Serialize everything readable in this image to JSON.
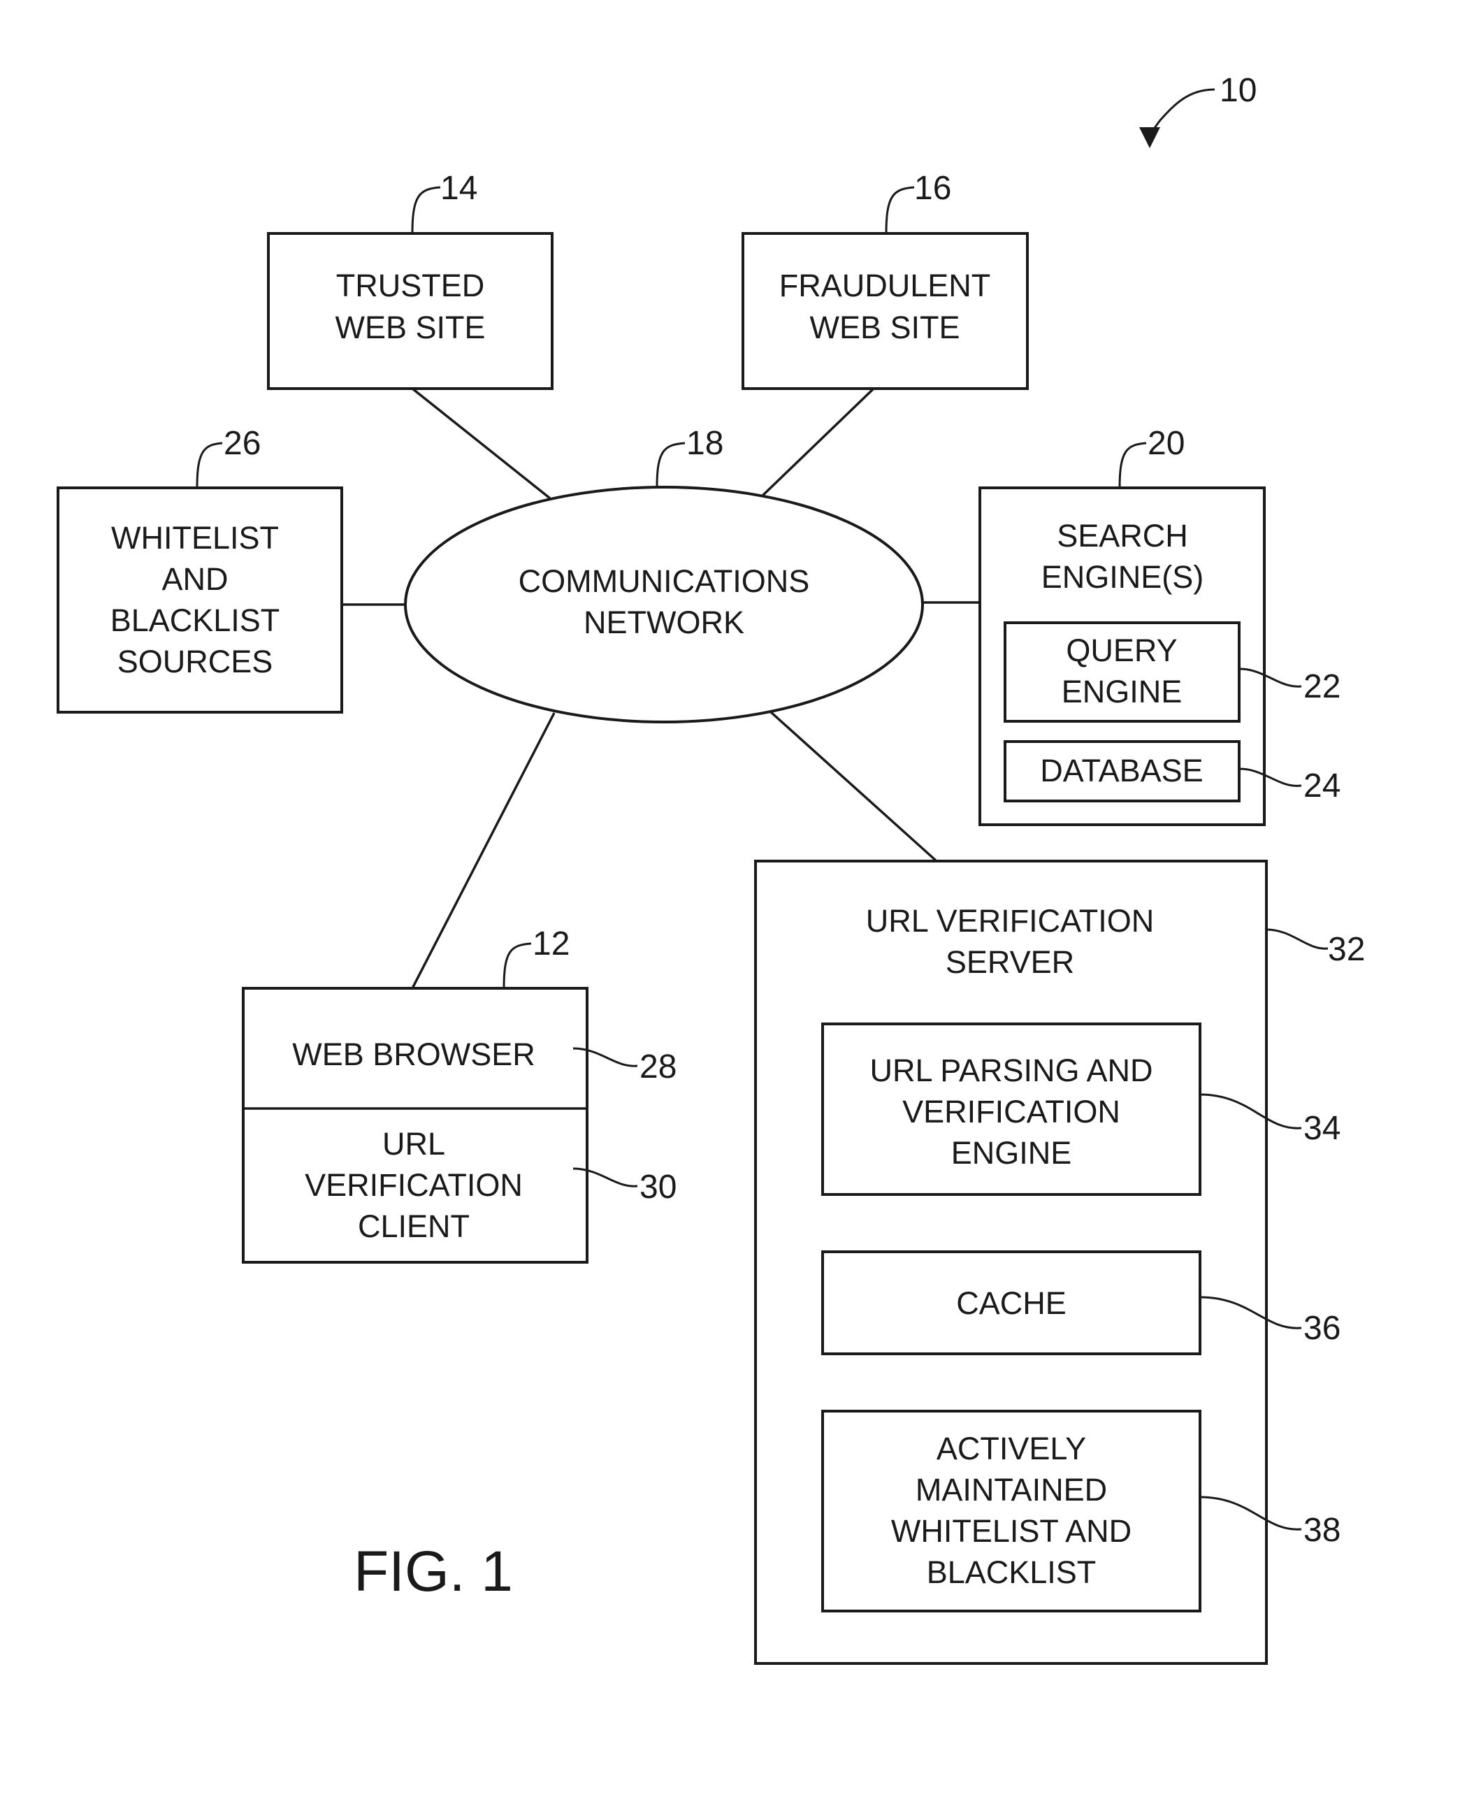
{
  "figure": {
    "caption": "FIG. 1",
    "system_ref": "10"
  },
  "nodes": {
    "trusted": {
      "ref": "14",
      "lines": [
        "TRUSTED",
        "WEB SITE"
      ]
    },
    "fraudulent": {
      "ref": "16",
      "lines": [
        "FRAUDULENT",
        "WEB SITE"
      ]
    },
    "network": {
      "ref": "18",
      "lines": [
        "COMMUNICATIONS",
        "NETWORK"
      ]
    },
    "lists_sources": {
      "ref": "26",
      "lines": [
        "WHITELIST",
        "AND",
        "BLACKLIST",
        "SOURCES"
      ]
    },
    "search": {
      "ref": "20",
      "lines": [
        "SEARCH",
        "ENGINE(S)"
      ],
      "query_engine": {
        "ref": "22",
        "lines": [
          "QUERY",
          "ENGINE"
        ]
      },
      "database": {
        "ref": "24",
        "lines": [
          "DATABASE"
        ]
      }
    },
    "client_device": {
      "ref": "12",
      "web_browser": {
        "ref": "28",
        "lines": [
          "WEB BROWSER"
        ]
      },
      "verification_client": {
        "ref": "30",
        "lines": [
          "URL",
          "VERIFICATION",
          "CLIENT"
        ]
      }
    },
    "server": {
      "ref": "32",
      "lines": [
        "URL VERIFICATION",
        "SERVER"
      ],
      "parsing_engine": {
        "ref": "34",
        "lines": [
          "URL PARSING AND",
          "VERIFICATION",
          "ENGINE"
        ]
      },
      "cache": {
        "ref": "36",
        "lines": [
          "CACHE"
        ]
      },
      "maintained_lists": {
        "ref": "38",
        "lines": [
          "ACTIVELY",
          "MAINTAINED",
          "WHITELIST AND",
          "BLACKLIST"
        ]
      }
    }
  }
}
